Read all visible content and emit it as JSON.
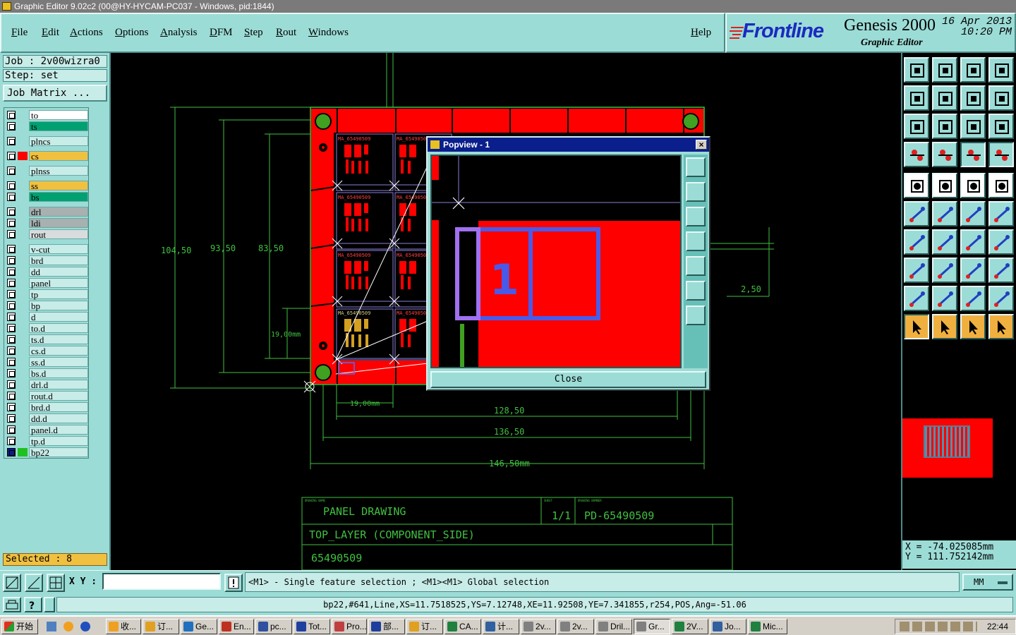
{
  "window": {
    "title": "Graphic Editor 9.02c2 (00@HY-HYCAM-PC037 - Windows, pid:1844)"
  },
  "menu": {
    "items": [
      "File",
      "Edit",
      "Actions",
      "Options",
      "Analysis",
      "DFM",
      "Step",
      "Rout",
      "Windows"
    ],
    "help": "Help"
  },
  "logo": {
    "brand": "Frontline",
    "product": "Genesis 2000",
    "subtitle": "Graphic Editor",
    "date": "16 Apr 2013",
    "time": "10:20 PM"
  },
  "job": {
    "job": "Job : 2v00wizra0",
    "step": "Step: set",
    "matrix_button": "Job Matrix ..."
  },
  "layers": [
    {
      "name": "to",
      "color": "#ffffff",
      "group": 0
    },
    {
      "name": "ts",
      "color": "#00a070",
      "group": 0
    },
    {
      "name": "plncs",
      "color": "#c8ece8",
      "group": 1
    },
    {
      "name": "cs",
      "color": "#f0c040",
      "swatch": "#ff0000",
      "group": 2
    },
    {
      "name": "plnss",
      "color": "#c8ece8",
      "group": 3
    },
    {
      "name": "ss",
      "color": "#f0c040",
      "group": 4
    },
    {
      "name": "bs",
      "color": "#00a070",
      "group": 4
    },
    {
      "name": "drl",
      "color": "#a8b0b0",
      "group": 5
    },
    {
      "name": "ldi",
      "color": "#a8b0b0",
      "group": 5
    },
    {
      "name": "rout",
      "color": "#d8dcdc",
      "group": 5
    },
    {
      "name": "v-cut",
      "color": "#c8ece8",
      "group": 6
    },
    {
      "name": "brd",
      "color": "#c8ece8",
      "group": 6
    },
    {
      "name": "dd",
      "color": "#c8ece8",
      "group": 6
    },
    {
      "name": "panel",
      "color": "#c8ece8",
      "group": 6
    },
    {
      "name": "tp",
      "color": "#c8ece8",
      "group": 6
    },
    {
      "name": "bp",
      "color": "#c8ece8",
      "group": 6
    },
    {
      "name": "d",
      "color": "#c8ece8",
      "group": 6
    },
    {
      "name": "to.d",
      "color": "#c8ece8",
      "group": 6
    },
    {
      "name": "ts.d",
      "color": "#c8ece8",
      "group": 6
    },
    {
      "name": "cs.d",
      "color": "#c8ece8",
      "group": 6
    },
    {
      "name": "ss.d",
      "color": "#c8ece8",
      "group": 6
    },
    {
      "name": "bs.d",
      "color": "#c8ece8",
      "group": 6
    },
    {
      "name": "drl.d",
      "color": "#c8ece8",
      "group": 6
    },
    {
      "name": "rout.d",
      "color": "#c8ece8",
      "group": 6
    },
    {
      "name": "brd.d",
      "color": "#c8ece8",
      "group": 6
    },
    {
      "name": "dd.d",
      "color": "#c8ece8",
      "group": 6
    },
    {
      "name": "panel.d",
      "color": "#c8ece8",
      "group": 6
    },
    {
      "name": "tp.d",
      "color": "#c8ece8",
      "group": 6
    },
    {
      "name": "bp22",
      "color": "#c8ece8",
      "swatch": "#20c020",
      "active": true,
      "group": 6
    }
  ],
  "selected": "Selected : 8",
  "drawing": {
    "dim_104": "104,50",
    "dim_93": "93,50",
    "dim_83": "83,50",
    "dim_19v": "19,00mm",
    "dim_19h": "19,00mm",
    "dim_128": "128,50",
    "dim_136": "136,50",
    "dim_146": "146,50mm",
    "dim_2_5": "2,50",
    "board_label": "MA_65490509",
    "title_block": {
      "name_label": "DRAWING NAME",
      "name": "PANEL DRAWING",
      "sheet_label": "SHEET",
      "sheet": "1/1",
      "num_label": "DRAWING NUMBER",
      "number": "PD-65490509",
      "layer": "TOP_LAYER (COMPONENT_SIDE)",
      "part": "65490509"
    }
  },
  "popview": {
    "title": "Popview - 1",
    "close_button": "Close",
    "close_x": "×",
    "pad_label": "1"
  },
  "coords": {
    "x": "X  =  -74.025085mm",
    "y": "Y  =  111.752142mm"
  },
  "cmd": {
    "xy_label": "X Y :",
    "xy_value": "",
    "prompt": "<M1> - Single feature selection ; <M1><M1> Global selection",
    "units": "MM"
  },
  "status": {
    "text": "bp22,#641,Line,XS=11.7518525,YS=7.12748,XE=11.92508,YE=7.341855,r254,POS,Ang=-51.06"
  },
  "taskbar": {
    "start": "开始",
    "items": [
      "收...",
      "订...",
      "Ge...",
      "En...",
      "pc...",
      "Tot...",
      "Pro...",
      "部...",
      "订...",
      "CA...",
      "计...",
      "2v...",
      "2v...",
      "Dril...",
      "Gr...",
      "2V...",
      "Jo...",
      "Mic..."
    ],
    "active_index": 14,
    "clock": "22:44"
  },
  "colors": {
    "panel": "#9cdcd6",
    "copper": "#ff0000",
    "outline": "#40c040",
    "selection": "#4a5ae8",
    "accent_text": "#1a2ac0"
  }
}
